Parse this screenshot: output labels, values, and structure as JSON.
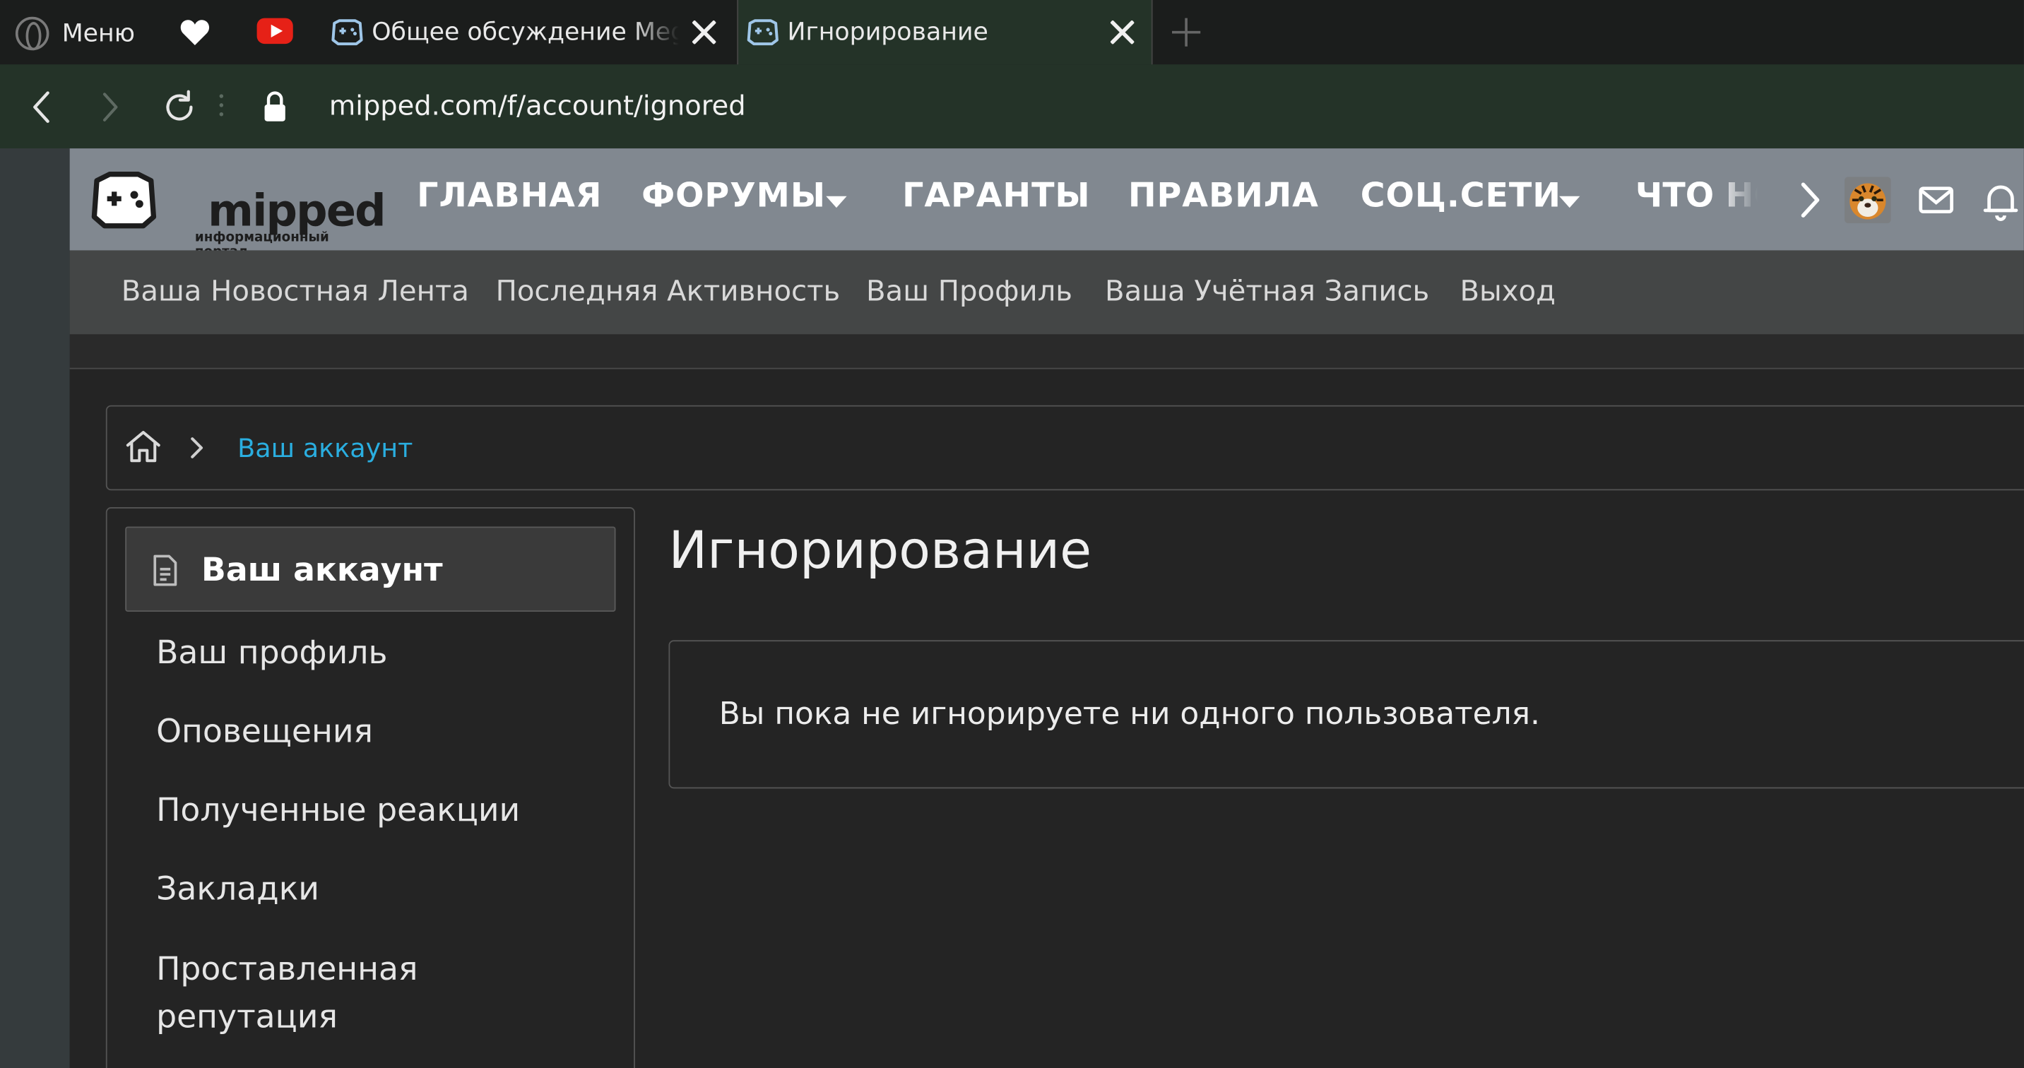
{
  "browser": {
    "menu_label": "Меню",
    "tabs": [
      {
        "title": "Общее обсуждение MegaMipped"
      },
      {
        "title": "Игнорирование"
      }
    ],
    "url": "mipped.com/f/account/ignored"
  },
  "site": {
    "logo_text": "mipped",
    "logo_subtitle": "информационный портал",
    "nav": [
      {
        "label": "ГЛАВНАЯ"
      },
      {
        "label": "ФОРУМЫ"
      },
      {
        "label": "ГАРАНТЫ"
      },
      {
        "label": "ПРАВИЛА"
      },
      {
        "label": "СОЦ.СЕТИ"
      },
      {
        "label": "ЧТО НОВОГО"
      }
    ],
    "subnav": [
      {
        "label": "Ваша Новостная Лента"
      },
      {
        "label": "Последняя Активность"
      },
      {
        "label": "Ваш Профиль"
      },
      {
        "label": "Ваша Учётная Запись"
      },
      {
        "label": "Выход"
      }
    ]
  },
  "breadcrumb": {
    "current": "Ваш аккаунт"
  },
  "sidebar": {
    "header": "Ваш аккаунт",
    "items": [
      {
        "label": "Ваш профиль"
      },
      {
        "label": "Оповещения"
      },
      {
        "label": "Полученные реакции"
      },
      {
        "label": "Закладки"
      },
      {
        "label": "Проставленная репутация"
      }
    ]
  },
  "main": {
    "title": "Игнорирование",
    "notice": "Вы пока не игнорируете ни одного пользователя."
  },
  "colors": {
    "link": "#2aaee0",
    "nav_bg": "#818890",
    "tab_active": "#243328"
  }
}
